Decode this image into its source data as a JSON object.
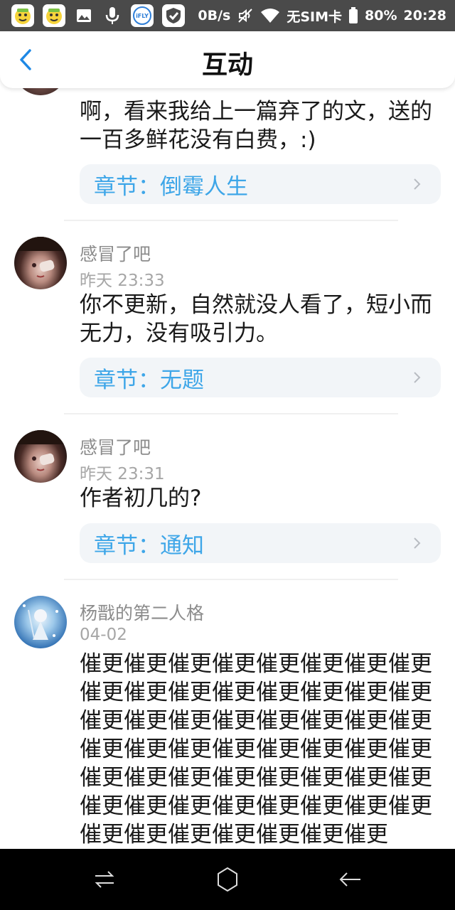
{
  "status_bar": {
    "net_speed": "0B/s",
    "sim": "无SIM卡",
    "battery": "80%",
    "time": "20:28",
    "icons": [
      "app-icon",
      "app-icon",
      "image-icon",
      "mic-icon",
      "ifly-icon",
      "shield-check-icon",
      "mute-icon",
      "wifi-icon",
      "battery-icon"
    ],
    "ifly_label": "iFLY"
  },
  "header": {
    "title": "互动",
    "accent": "#1e88e5"
  },
  "comments": [
    {
      "message": "啊，看来我给上一篇弃了的文，送的一百多鲜花没有白费，:)",
      "chapter": "章节：倒霉人生"
    },
    {
      "username": "感冒了吧",
      "time": "昨天 23:33",
      "message": "你不更新，自然就没人看了，短小而无力，没有吸引力。",
      "chapter": "章节：无题"
    },
    {
      "username": "感冒了吧",
      "time": "昨天 23:31",
      "message": "作者初几的?",
      "chapter": "章节：通知"
    },
    {
      "username": "杨戬的第二人格",
      "time": "04-02",
      "message": "催更催更催更催更催更催更催更催更催更催更催更催更催更催更催更催更催更催更催更催更催更催更催更催更催更催更催更催更催更催更催更催更催更催更催更催更催更催更催更催更催更催更催更催更催更催更催更催更催更催更催更催更催更催更催更"
    }
  ],
  "colors": {
    "chapter_text": "#3ea6e8",
    "chapter_bg": "#f2f5f8",
    "username": "#8c8c8c"
  },
  "nav_bar": {
    "icons": [
      "switch-apps-icon",
      "home-icon",
      "back-icon"
    ]
  }
}
